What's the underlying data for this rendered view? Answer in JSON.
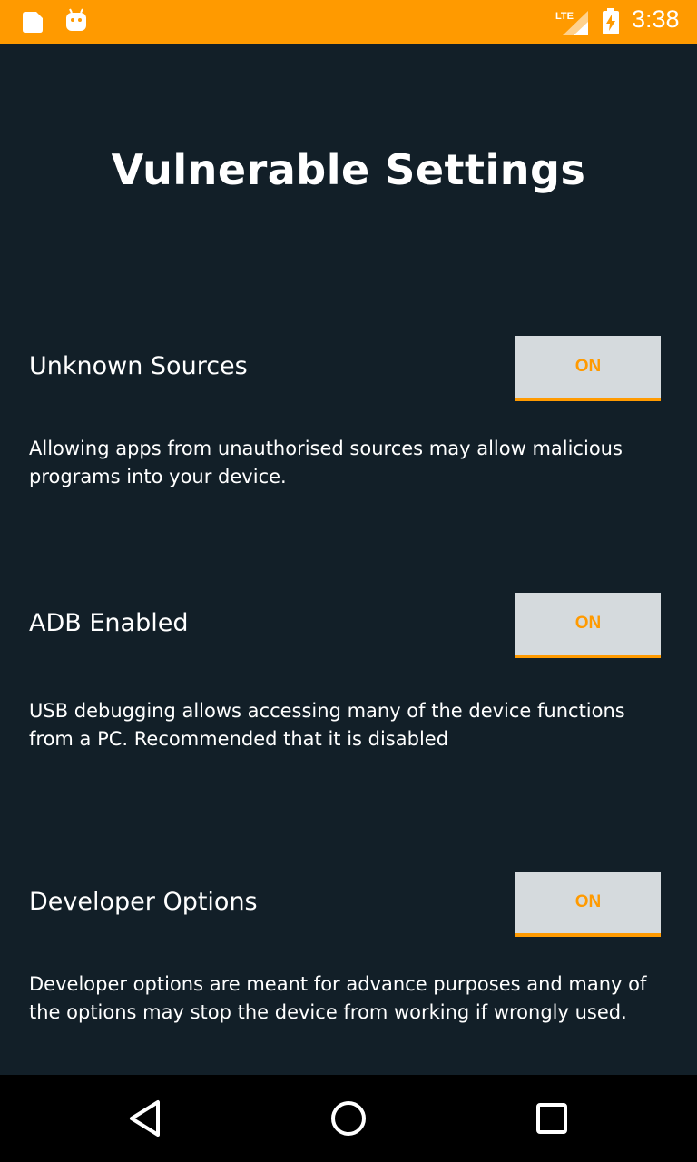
{
  "status_bar": {
    "time": "3:38",
    "network": "LTE",
    "icons": [
      "document-icon",
      "android-icon",
      "lte-signal-icon",
      "battery-charging-icon"
    ]
  },
  "page": {
    "title": "Vulnerable Settings"
  },
  "settings": [
    {
      "label": "Unknown Sources",
      "toggle": "ON",
      "description": "Allowing apps from unauthorised sources may allow malicious programs into your device."
    },
    {
      "label": "ADB Enabled",
      "toggle": "ON",
      "description": "USB debugging allows accessing many of the device functions from a PC. Recommended that it is disabled"
    },
    {
      "label": "Developer Options",
      "toggle": "ON",
      "description": "Developer options are meant for advance purposes and many of the options may stop the device from working if wrongly used."
    }
  ],
  "nav_bar": {
    "icons": [
      "back-icon",
      "home-icon",
      "recents-icon"
    ]
  },
  "colors": {
    "accent": "#ff9a00",
    "background": "#121f28",
    "toggle_bg": "#d5dadd",
    "nav_bg": "#000000"
  }
}
